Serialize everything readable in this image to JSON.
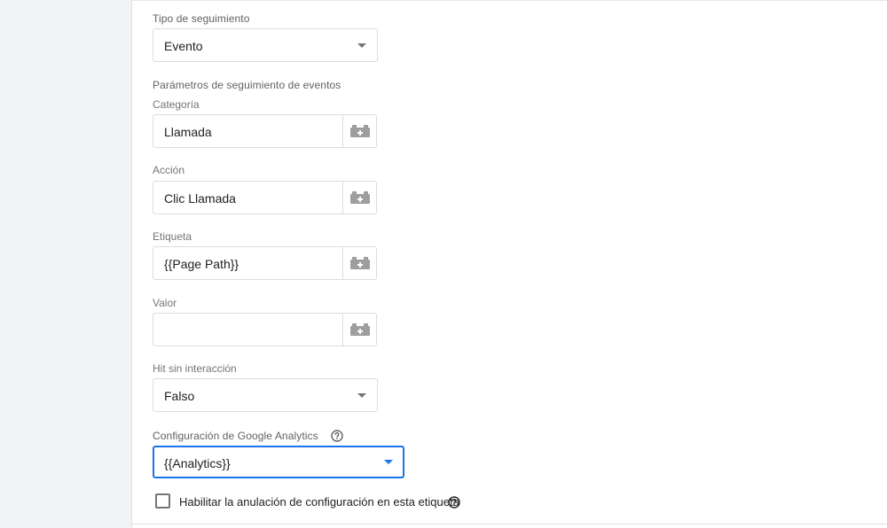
{
  "tracking_type": {
    "label": "Tipo de seguimiento",
    "value": "Evento"
  },
  "event_params": {
    "heading": "Parámetros de seguimiento de eventos",
    "category": {
      "label": "Categoría",
      "value": "Llamada"
    },
    "action": {
      "label": "Acción",
      "value": "Clic Llamada"
    },
    "tag_label": {
      "label": "Etiqueta",
      "value": "{{Page Path}}"
    },
    "value": {
      "label": "Valor",
      "value": ""
    }
  },
  "non_interaction": {
    "label": "Hit sin interacción",
    "value": "Falso"
  },
  "ga_settings": {
    "label": "Configuración de Google Analytics",
    "value": "{{Analytics}}"
  },
  "override": {
    "label": "Habilitar la anulación de configuración en esta etiqueta",
    "checked": false
  },
  "colors": {
    "accent": "#1a73e8",
    "icon_grey": "#9e9e9e",
    "border": "#dadce0"
  },
  "icons": {
    "variable": "variable-brick-icon",
    "help": "help-circle-icon",
    "dropdown": "caret-down-icon"
  }
}
